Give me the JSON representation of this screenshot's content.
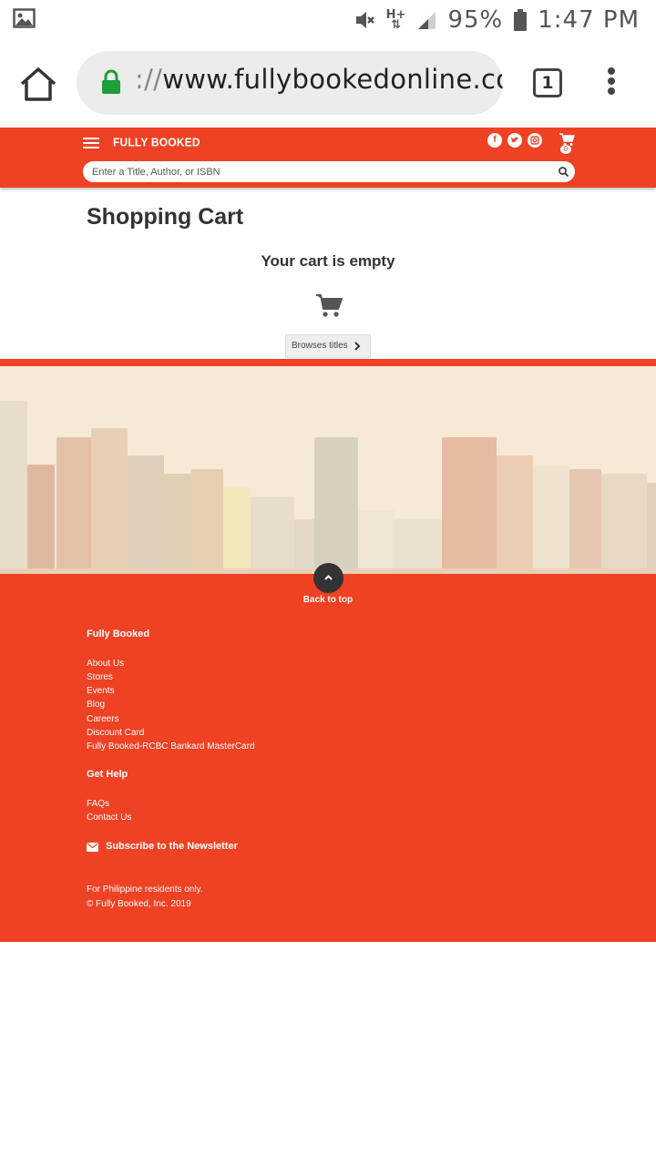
{
  "status_bar": {
    "battery_percent": "95%",
    "time": "1:47 PM",
    "network": "H+"
  },
  "browser": {
    "url_scheme": "://",
    "url_host": "www.fullybookedonline.com",
    "tab_count": "1"
  },
  "header": {
    "logo": "FULLY BOOKED",
    "cart_count": "0",
    "search_placeholder": "Enter a Title, Author, or ISBN"
  },
  "main": {
    "title": "Shopping Cart",
    "empty_message": "Your cart is empty",
    "browse_button": "Browses titles"
  },
  "footer": {
    "back_to_top": "Back to top",
    "section1_heading": "Fully Booked",
    "section1_links": [
      "About Us",
      "Stores",
      "Events",
      "Blog",
      "Careers",
      "Discount Card",
      "Fully Booked-RCBC Bankard MasterCard"
    ],
    "section2_heading": "Get Help",
    "section2_links": [
      "FAQs",
      "Contact Us"
    ],
    "newsletter": "Subscribe to the Newsletter",
    "note": "For Philippine residents only.",
    "copyright": "© Fully Booked, Inc. 2019"
  },
  "colors": {
    "brand": "#ef4123",
    "text_dark": "#333333"
  },
  "icons": [
    "gallery-icon",
    "mute-icon",
    "signal-icon",
    "battery-icon",
    "home-icon",
    "lock-icon",
    "overflow-menu-icon",
    "hamburger-icon",
    "facebook-icon",
    "twitter-icon",
    "instagram-icon",
    "cart-icon",
    "search-icon",
    "chevron-right-icon",
    "chevron-up-icon",
    "envelope-icon"
  ]
}
